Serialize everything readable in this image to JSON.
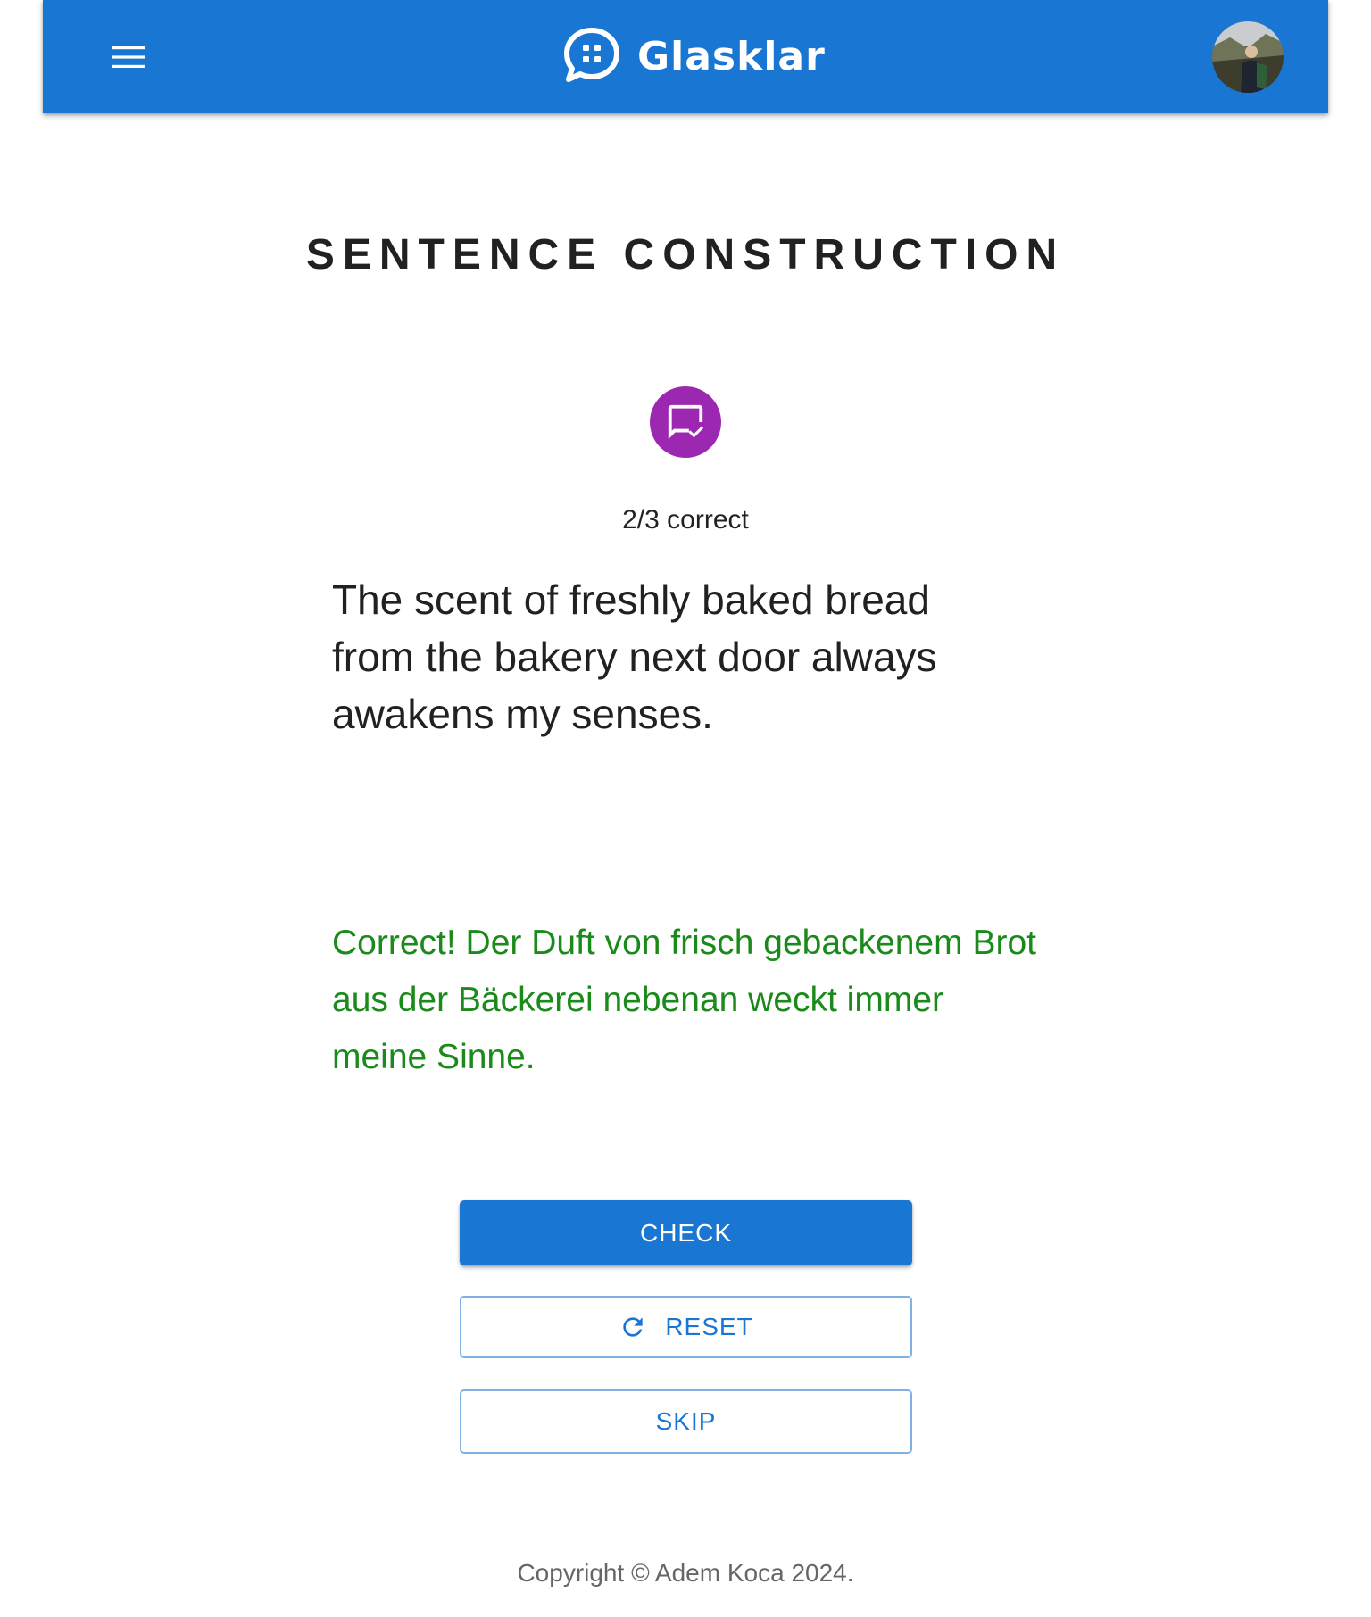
{
  "app": {
    "name": "Glasklar",
    "brand_color": "#1976d2"
  },
  "header": {
    "menu_icon": "hamburger-menu-icon",
    "logo_icon": "chat-bubble-logo-icon",
    "avatar_icon": "user-avatar-photo"
  },
  "exercise": {
    "title": "SENTENCE CONSTRUCTION",
    "badge_icon": "chat-check-icon",
    "badge_color": "#9c27b0",
    "score": "2/3 correct",
    "prompt": "The scent of freshly baked bread from the bakery next door always awakens my senses.",
    "feedback": "Correct! Der Duft von frisch gebackenem Brot aus der Bäckerei nebenan weckt immer meine Sinne.",
    "feedback_color": "#1a8a1a"
  },
  "actions": {
    "check_label": "CHECK",
    "reset_label": "RESET",
    "reset_icon": "refresh-icon",
    "skip_label": "SKIP"
  },
  "footer": {
    "copyright": "Copyright © Adem Koca 2024."
  }
}
